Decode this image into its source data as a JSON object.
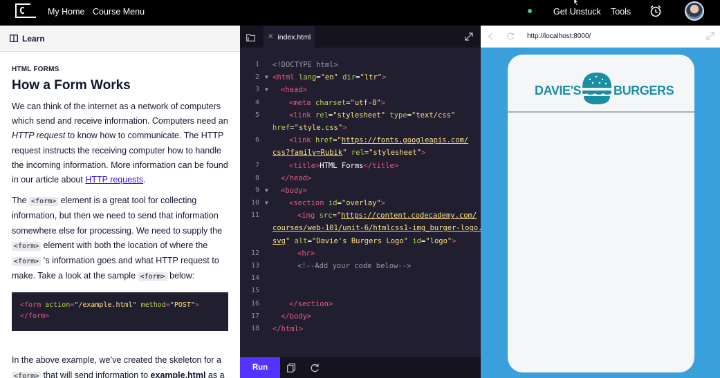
{
  "nav": {
    "logo_glyph": "C",
    "my_home": "My Home",
    "course_menu": "Course Menu",
    "get_unstuck": "Get Unstuck",
    "tools": "Tools"
  },
  "learn": {
    "panel_title": "Learn",
    "eyebrow": "HTML FORMS",
    "heading": "How a Form Works",
    "p1": {
      "a": "We can think of the internet as a network of computers which send and receive information. Computers need an ",
      "em": "HTTP request",
      "b": " to know how to communicate. The HTTP request instructs the receiving computer how to handle the incoming information. More information can be found in our article about ",
      "link": "HTTP requests",
      "c": "."
    },
    "p2": {
      "a": "The ",
      "code1": "<form>",
      "b": " element is a great tool for collecting information, but then we need to send that information somewhere else for processing. We need to supply the ",
      "code2": "<form>",
      "c": " element with both the location of where the ",
      "code3": "<form>",
      "d": " ‘s information goes and what HTTP request to make. Take a look at the sample ",
      "code4": "<form>",
      "e": " below:"
    },
    "sample": {
      "open": "<form",
      "attr1": " action",
      "eq1": "=",
      "val1": "\"/example.html\"",
      "attr2": " method",
      "eq2": "=",
      "val2": "\"POST\"",
      "gt": ">",
      "close": "</form>"
    },
    "p3": {
      "a": "In the above example, we’ve created the skeleton for a ",
      "code1": "<form>",
      "b": " that will send information to ",
      "strong": "example.html",
      "c": " as a"
    }
  },
  "editor": {
    "tab_name": "index.html",
    "run_label": "Run",
    "lines": [
      {
        "n": "1",
        "fold": false
      },
      {
        "n": "2",
        "fold": true
      },
      {
        "n": "3",
        "fold": true
      },
      {
        "n": "4",
        "fold": false
      },
      {
        "n": "5",
        "fold": false
      },
      {
        "n": "",
        "fold": false
      },
      {
        "n": "6",
        "fold": false
      },
      {
        "n": "",
        "fold": false
      },
      {
        "n": "7",
        "fold": false
      },
      {
        "n": "8",
        "fold": false
      },
      {
        "n": "9",
        "fold": true
      },
      {
        "n": "10",
        "fold": true
      },
      {
        "n": "11",
        "fold": false
      },
      {
        "n": "",
        "fold": false
      },
      {
        "n": "",
        "fold": false
      },
      {
        "n": "12",
        "fold": false
      },
      {
        "n": "13",
        "fold": false
      },
      {
        "n": "14",
        "fold": false
      },
      {
        "n": "15",
        "fold": false
      },
      {
        "n": "16",
        "fold": false
      },
      {
        "n": "17",
        "fold": false
      },
      {
        "n": "18",
        "fold": false
      }
    ],
    "code": {
      "l1": "<!DOCTYPE html>",
      "l2a": "<html ",
      "l2b": "lang",
      "l2c": "=",
      "l2d": "\"en\"",
      "l2e": " dir",
      "l2f": "=",
      "l2g": "\"ltr\"",
      "l2h": ">",
      "l3": "<head>",
      "l4a": "<meta ",
      "l4b": "charset",
      "l4c": "=",
      "l4d": "\"utf-8\"",
      "l4e": ">",
      "l5a": "<link ",
      "l5b": "rel",
      "l5c": "=",
      "l5d": "\"stylesheet\"",
      "l5e": " type",
      "l5f": "=",
      "l5g": "\"text/css\"",
      "l5wa": "href",
      "l5wb": "=",
      "l5wc": "\"style.css\"",
      "l5wd": ">",
      "l6a": "<link ",
      "l6b": "href",
      "l6c": "=\"",
      "l6d": "https://fonts.googleapis.com/",
      "l6wa": "css?family=Rubik",
      "l6wb": "\"",
      "l6wc": " rel",
      "l6wd": "=",
      "l6we": "\"stylesheet\"",
      "l6wf": ">",
      "l7a": "<title>",
      "l7b": "HTML Forms",
      "l7c": "</title>",
      "l8": "</head>",
      "l9": "<body>",
      "l10a": "<section ",
      "l10b": "id",
      "l10c": "=",
      "l10d": "\"overlay\"",
      "l10e": ">",
      "l11a": "<img ",
      "l11b": "src",
      "l11c": "=\"",
      "l11d": "https://content.codecademy.com/",
      "l11wa": "courses/web-101/unit-6/htmlcss1-img_burger-logo.",
      "l11xa": "svg",
      "l11xb": "\"",
      "l11xc": " alt",
      "l11xd": "=",
      "l11xe": "\"Davie's Burgers Logo\"",
      "l11xf": " id",
      "l11xg": "=",
      "l11xh": "\"logo\"",
      "l11xi": ">",
      "l12": "<hr>",
      "l13": "<!--Add your code below-->",
      "l16": "</section>",
      "l17": "</body>",
      "l18": "</html>"
    }
  },
  "browser": {
    "url": "http://localhost:8000/",
    "brand_left": "DAVIE'S",
    "brand_right": "BURGERS",
    "background_color": "#3aa0dc",
    "brand_color": "#1a8ea3"
  },
  "icons": [
    "alarm-icon",
    "book-icon",
    "folder-icon",
    "close-icon",
    "expand-icon",
    "copy-icon",
    "reset-icon",
    "back-icon",
    "reload-icon",
    "fullscreen-icon",
    "cursor-icon"
  ],
  "colors": {
    "run_button": "#5533ff",
    "editor_bg": "#211e2f",
    "tag": "#e85d7f",
    "attr": "#b4d353",
    "string": "#ffe083",
    "link": "#3a10e5",
    "status_dot": "#33d1ac"
  }
}
